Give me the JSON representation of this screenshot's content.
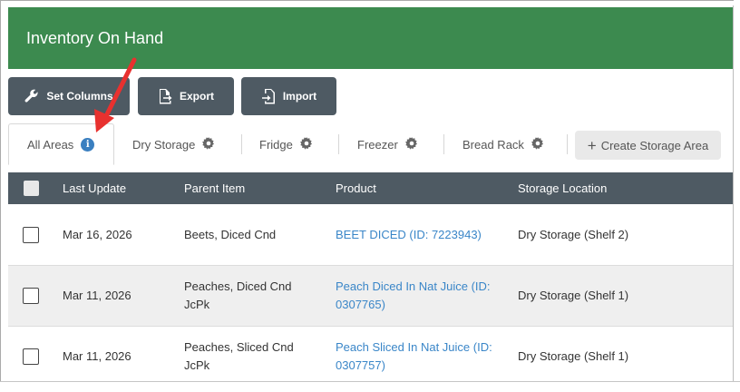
{
  "header": {
    "title": "Inventory On Hand"
  },
  "toolbar": {
    "set_columns": "Set Columns",
    "export": "Export",
    "import": "Import"
  },
  "tabs": [
    {
      "label": "All Areas",
      "icon": "info-icon"
    },
    {
      "label": "Dry Storage",
      "icon": "gear-icon"
    },
    {
      "label": "Fridge",
      "icon": "gear-icon"
    },
    {
      "label": "Freezer",
      "icon": "gear-icon"
    },
    {
      "label": "Bread Rack",
      "icon": "gear-icon"
    }
  ],
  "create_storage_area": "Create Storage Area",
  "table": {
    "columns": [
      "Last Update",
      "Parent Item",
      "Product",
      "Storage Location"
    ],
    "rows": [
      {
        "last_update": "Mar 16, 2026",
        "parent_item": "Beets, Diced Cnd",
        "parent_item_2": "",
        "product": "BEET DICED (ID: 7223943)",
        "product_2": "",
        "location": "Dry Storage (Shelf 2)"
      },
      {
        "last_update": "Mar 11, 2026",
        "parent_item": "Peaches, Diced Cnd",
        "parent_item_2": "JcPk",
        "product": "Peach Diced In Nat Juice (ID:",
        "product_2": "0307765)",
        "location": "Dry Storage (Shelf 1)"
      },
      {
        "last_update": "Mar 11, 2026",
        "parent_item": "Peaches, Sliced Cnd",
        "parent_item_2": "JcPk",
        "product": "Peach Sliced In Nat Juice (ID:",
        "product_2": "0307757)",
        "location": "Dry Storage (Shelf 1)"
      }
    ]
  },
  "colors": {
    "header_green": "#3c8a4f",
    "toolbar_gray": "#4e5a63",
    "link_blue": "#3a86c8",
    "annotation_red": "#e8312f"
  }
}
